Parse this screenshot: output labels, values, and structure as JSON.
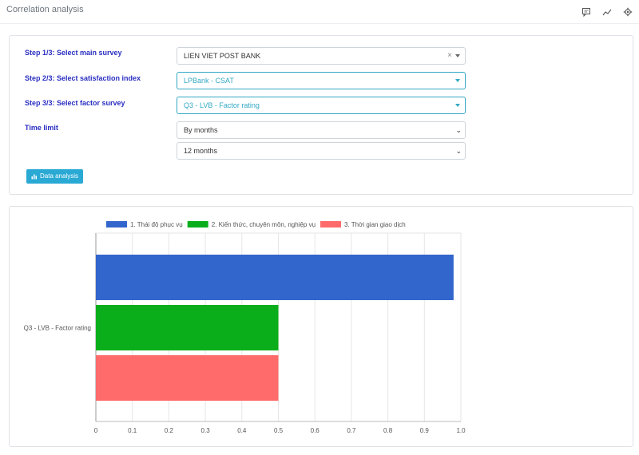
{
  "header": {
    "title": "Correlation analysis",
    "icons": [
      "comment-icon",
      "trend-line-icon",
      "gear-icon"
    ]
  },
  "form": {
    "step1": {
      "label": "Step 1/3: Select main survey",
      "value": "LIEN VIET POST BANK",
      "clear": "×"
    },
    "step2": {
      "label": "Step 2/3: Select satisfaction index",
      "value": "LPBank - CSAT"
    },
    "step3": {
      "label": "Step 3/3: Select factor survey",
      "value": "Q3 - LVB - Factor rating"
    },
    "time": {
      "label": "Time limit",
      "period": "By months",
      "range": "12 months"
    },
    "button_label": "Data analysis"
  },
  "colors": {
    "accent": "#31a8c4",
    "step_label": "#2a2ec0",
    "button": "#29a9d4"
  },
  "chart_data": {
    "type": "bar",
    "orientation": "horizontal",
    "categories": [
      "Q3 -  LVB - Factor rating"
    ],
    "series": [
      {
        "name": "1. Thái độ phục vụ",
        "values": [
          0.98
        ],
        "color": "#3366cc"
      },
      {
        "name": "2. Kiến thức, chuyên môn, nghiệp vụ",
        "values": [
          0.5
        ],
        "color": "#0aae1b"
      },
      {
        "name": "3. Thời gian giao dịch",
        "values": [
          0.5
        ],
        "color": "#ff6b6b"
      }
    ],
    "xlim": [
      0,
      1
    ],
    "xticks": [
      "0",
      "0.1",
      "0.2",
      "0.3",
      "0.4",
      "0.5",
      "0.6",
      "0.7",
      "0.8",
      "0.9",
      "1.0"
    ],
    "legend": "top",
    "grid": true
  }
}
